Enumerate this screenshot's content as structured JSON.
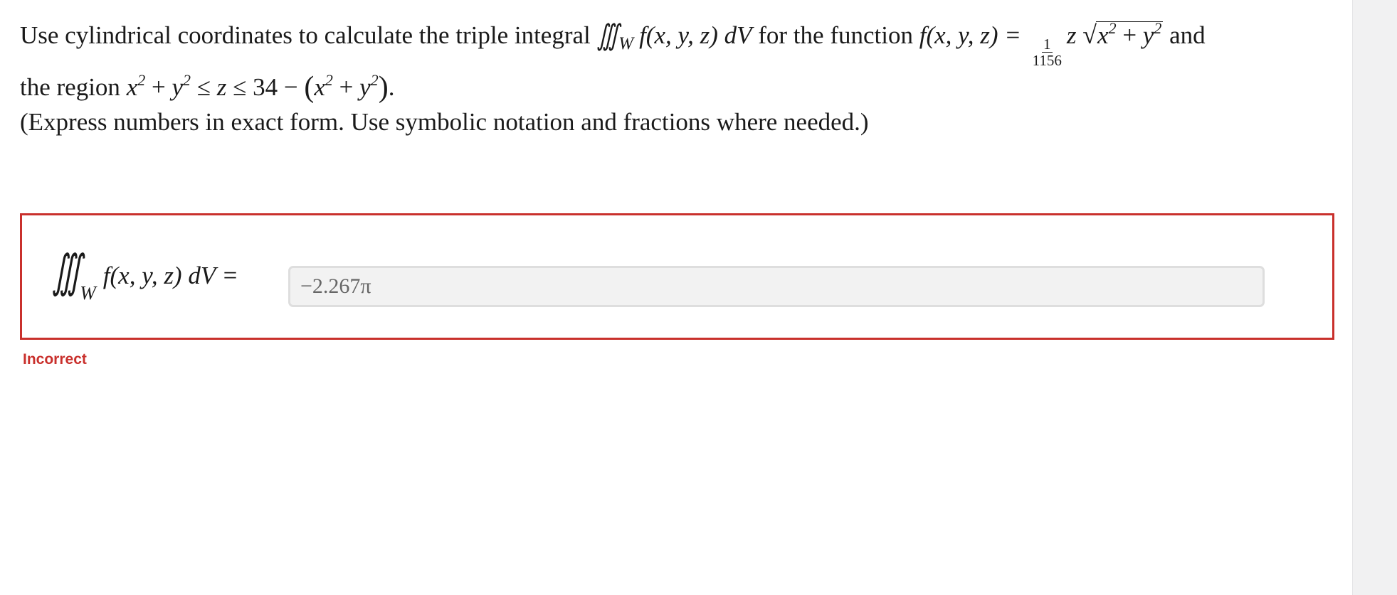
{
  "question": {
    "text_before_integral": "Use cylindrical coordinates to calculate the triple integral",
    "integral_symbol": "∭",
    "integral_subscript": "W",
    "integrand": "f(x, y, z) dV",
    "text_for_function": "for the function",
    "function_lhs": "f(x, y, z) =",
    "fraction_numerator": "1",
    "fraction_denominator": "1156",
    "function_factor": "z",
    "radical_symbol": "√",
    "radicand_x": "x",
    "radicand_x_exp": "2",
    "radicand_plus": "+",
    "radicand_y": "y",
    "radicand_y_exp": "2",
    "text_and": "and",
    "text_region": "the region",
    "region_x": "x",
    "region_x_exp": "2",
    "region_plus_1": "+",
    "region_y": "y",
    "region_y_exp": "2",
    "region_leq_1": "≤",
    "region_z": "z",
    "region_leq_2": "≤",
    "region_const": "34",
    "region_minus": "−",
    "region_lparen": "(",
    "region_x2": "x",
    "region_x2_exp": "2",
    "region_plus_2": "+",
    "region_y2": "y",
    "region_y2_exp": "2",
    "region_rparen": ")",
    "region_period": "."
  },
  "instructions": "(Express numbers in exact form. Use symbolic notation and fractions where needed.)",
  "answer": {
    "integral_symbol": "∭",
    "integral_subscript": "W",
    "lhs": "f(x, y, z) dV =",
    "input_value": "−2.267π"
  },
  "status": {
    "text": "Incorrect",
    "color": "#c9302c"
  }
}
